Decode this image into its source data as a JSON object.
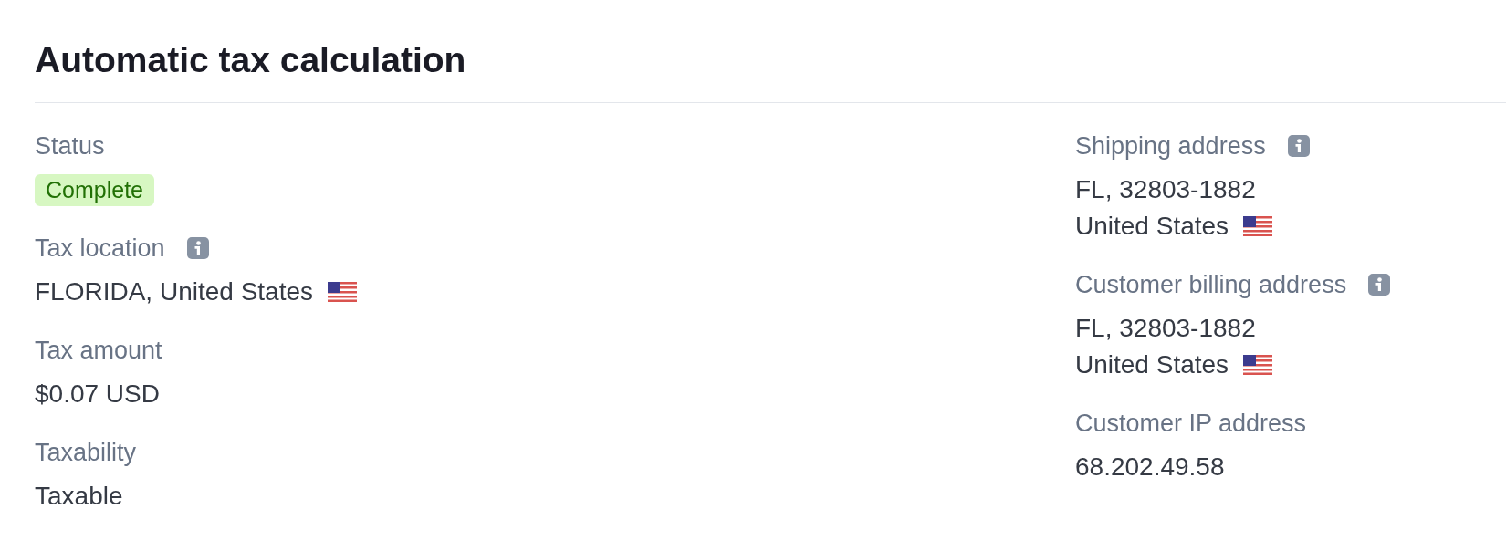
{
  "title": "Automatic tax calculation",
  "columns": [
    {
      "fields": [
        {
          "label": "Status",
          "info": false,
          "kind": "badge",
          "lines": [
            {
              "text": "Complete",
              "flag": false
            }
          ]
        },
        {
          "label": "Tax location",
          "info": true,
          "kind": "text",
          "lines": [
            {
              "text": "FLORIDA, United States",
              "flag": true
            }
          ]
        },
        {
          "label": "Tax amount",
          "info": false,
          "kind": "text",
          "lines": [
            {
              "text": "$0.07 USD",
              "flag": false
            }
          ]
        },
        {
          "label": "Taxability",
          "info": false,
          "kind": "text",
          "lines": [
            {
              "text": "Taxable",
              "flag": false
            }
          ]
        }
      ]
    },
    {
      "fields": [
        {
          "label": "Shipping address",
          "info": true,
          "kind": "text",
          "lines": [
            {
              "text": "FL, 32803-1882",
              "flag": false
            },
            {
              "text": "United States",
              "flag": true
            }
          ]
        },
        {
          "label": "Customer billing address",
          "info": true,
          "kind": "text",
          "lines": [
            {
              "text": "FL, 32803-1882",
              "flag": false
            },
            {
              "text": "United States",
              "flag": true
            }
          ]
        },
        {
          "label": "Customer IP address",
          "info": false,
          "kind": "text",
          "lines": [
            {
              "text": "68.202.49.58",
              "flag": false
            }
          ]
        }
      ]
    }
  ]
}
